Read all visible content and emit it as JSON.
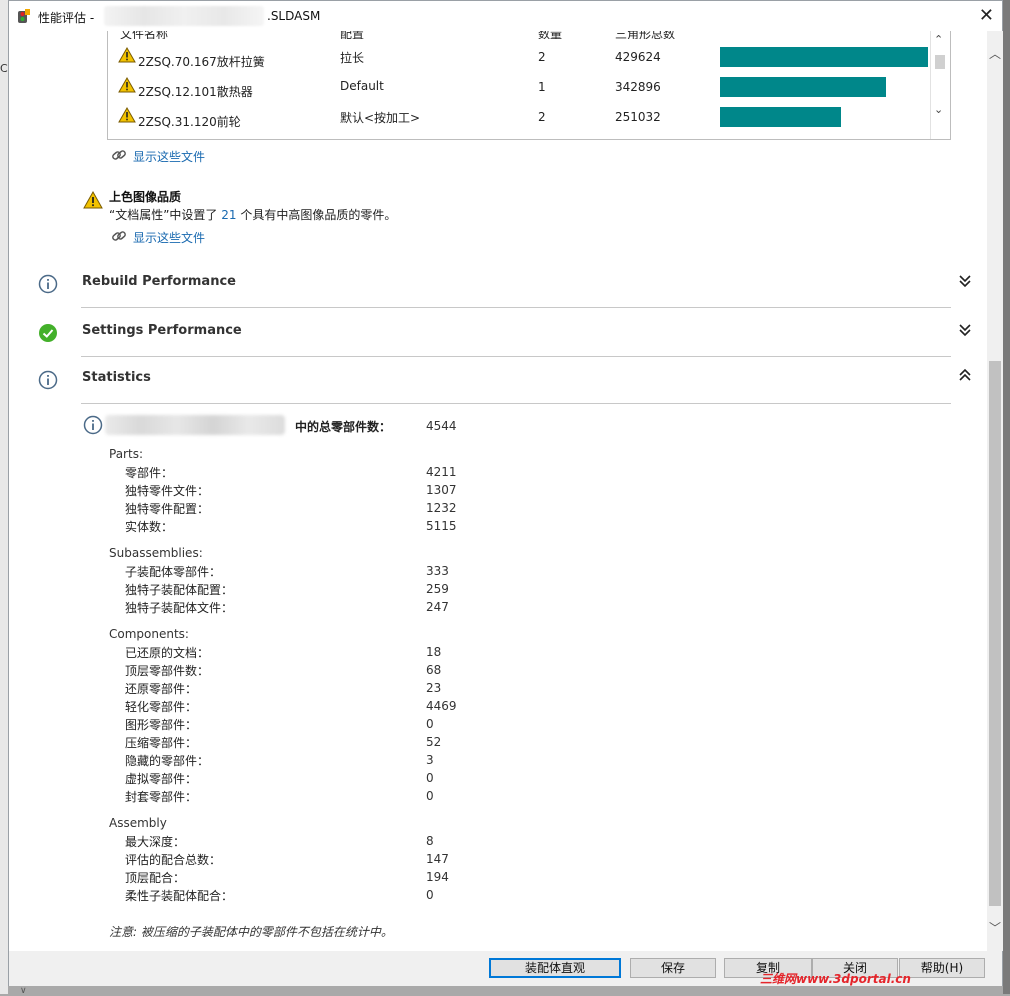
{
  "window": {
    "title_prefix": "性能评估 - ",
    "title_suffix": ".SLDASM",
    "close_glyph": "✕"
  },
  "background": {
    "left_mark": "C",
    "bottom_mark": "∨"
  },
  "file_list": {
    "headers": {
      "name": "文件名称",
      "config": "配置",
      "qty": "数量",
      "triangles": "三角形总数"
    },
    "rows": [
      {
        "name": "2ZSQ.70.167放杆拉簧",
        "config": "拉长",
        "qty": "2",
        "triangles": "429624",
        "bar_fraction": 1.0
      },
      {
        "name": "2ZSQ.12.101散热器",
        "config": "Default",
        "qty": "1",
        "triangles": "342896",
        "bar_fraction": 0.798
      },
      {
        "name": "2ZSQ.31.120前轮",
        "config": "默认<按加工>",
        "qty": "2",
        "triangles": "251032",
        "bar_fraction": 0.584
      }
    ],
    "show_files_link": "显示这些文件"
  },
  "image_quality": {
    "title": "上色图像品质",
    "desc_before": "“文档属性”中设置了 ",
    "count": "21",
    "desc_after": " 个具有中高图像品质的零件。",
    "show_files_link": "显示这些文件"
  },
  "sections": {
    "rebuild": "Rebuild Performance",
    "settings": "Settings Performance",
    "statistics": "Statistics"
  },
  "statistics": {
    "total_label": "中的总零部件数：",
    "total_value": "4544",
    "groups": [
      {
        "title": "Parts:",
        "items": [
          {
            "label": "零部件：",
            "value": "4211"
          },
          {
            "label": "独特零件文件：",
            "value": "1307"
          },
          {
            "label": "独特零件配置：",
            "value": "1232"
          },
          {
            "label": "实体数：",
            "value": "5115"
          }
        ]
      },
      {
        "title": "Subassemblies:",
        "items": [
          {
            "label": "子装配体零部件：",
            "value": "333"
          },
          {
            "label": "独特子装配体配置：",
            "value": "259"
          },
          {
            "label": "独特子装配体文件：",
            "value": "247"
          }
        ]
      },
      {
        "title": "Components:",
        "items": [
          {
            "label": "已还原的文档：",
            "value": "18"
          },
          {
            "label": "顶层零部件数：",
            "value": "68"
          },
          {
            "label": "还原零部件：",
            "value": "23"
          },
          {
            "label": "轻化零部件：",
            "value": "4469"
          },
          {
            "label": "图形零部件：",
            "value": "0"
          },
          {
            "label": "压缩零部件：",
            "value": "52"
          },
          {
            "label": "隐藏的零部件：",
            "value": "3"
          },
          {
            "label": "虚拟零部件：",
            "value": "0"
          },
          {
            "label": "封套零部件：",
            "value": "0"
          }
        ]
      },
      {
        "title": "Assembly",
        "items": [
          {
            "label": "最大深度：",
            "value": "8"
          },
          {
            "label": "评估的配合总数：",
            "value": "147"
          },
          {
            "label": "顶层配合：",
            "value": "194"
          },
          {
            "label": "柔性子装配体配合：",
            "value": "0"
          }
        ]
      }
    ],
    "note": "注意: 被压缩的子装配体中的零部件不包括在统计中。"
  },
  "buttons": {
    "assembly_view": "装配体直观",
    "save": "保存",
    "copy": "复制",
    "close": "关闭",
    "help": "帮助(H)"
  },
  "watermark": "三维网www.3dportal.cn",
  "colors": {
    "bar": "#00878a",
    "link": "#1a6ab0",
    "warning": "#f2c200",
    "ok": "#43b02a",
    "info": "#4b6a88",
    "accent": "#0078d7"
  }
}
